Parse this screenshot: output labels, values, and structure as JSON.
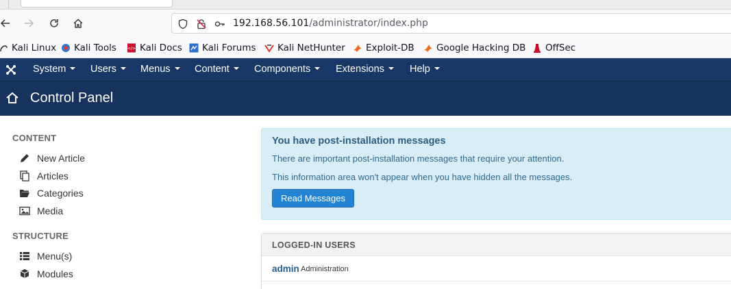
{
  "browser": {
    "url_host": "192.168.56.101",
    "url_path": "/administrator/index.php",
    "bookmarks": [
      {
        "label": "Kali Linux",
        "icon": "kali-dragon-icon"
      },
      {
        "label": "Kali Tools",
        "icon": "kali-tools-icon"
      },
      {
        "label": "Kali Docs",
        "icon": "kali-docs-icon"
      },
      {
        "label": "Kali Forums",
        "icon": "kali-forums-icon"
      },
      {
        "label": "Kali NetHunter",
        "icon": "kali-nethunter-icon"
      },
      {
        "label": "Exploit-DB",
        "icon": "exploit-db-icon"
      },
      {
        "label": "Google Hacking DB",
        "icon": "ghdb-icon"
      },
      {
        "label": "OffSec",
        "icon": "offsec-icon"
      }
    ]
  },
  "topmenu": {
    "items": [
      "System",
      "Users",
      "Menus",
      "Content",
      "Components",
      "Extensions",
      "Help"
    ]
  },
  "header": {
    "title": "Control Panel"
  },
  "sidebar": {
    "content_heading": "CONTENT",
    "content_items": [
      "New Article",
      "Articles",
      "Categories",
      "Media"
    ],
    "structure_heading": "STRUCTURE",
    "structure_items": [
      "Menu(s)",
      "Modules"
    ]
  },
  "alert": {
    "heading": "You have post-installation messages",
    "line1": "There are important post-installation messages that require your attention.",
    "line2": "This information area won't appear when you have hidden all the messages.",
    "button": "Read Messages"
  },
  "logged_in": {
    "heading": "LOGGED-IN USERS",
    "user": "admin",
    "role": "Administration"
  },
  "colors": {
    "nav_bg": "#1a3867",
    "title_bg": "#17325c",
    "alert_bg": "#d9edf7",
    "button_bg": "#2384d3"
  }
}
